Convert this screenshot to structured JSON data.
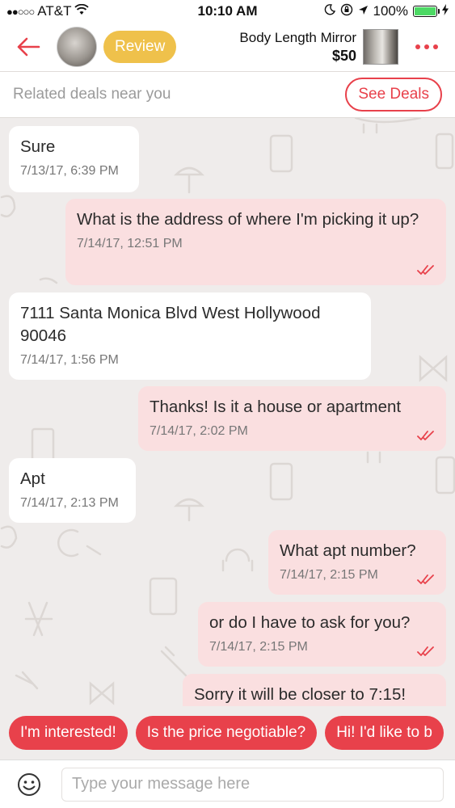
{
  "status_bar": {
    "carrier": "AT&T",
    "time": "10:10 AM",
    "battery": "100%"
  },
  "header": {
    "review_label": "Review",
    "listing_title": "Body Length Mirror",
    "listing_price": "$50"
  },
  "deals": {
    "text": "Related deals near you",
    "button": "See Deals"
  },
  "messages": [
    {
      "dir": "in",
      "text": "Sure",
      "time": "7/13/17, 6:39 PM"
    },
    {
      "dir": "out",
      "text": "What is the address of where I'm picking it up?",
      "time": "7/14/17, 12:51 PM"
    },
    {
      "dir": "in",
      "text": "7111 Santa Monica Blvd West Hollywood 90046",
      "time": "7/14/17, 1:56 PM"
    },
    {
      "dir": "out",
      "text": "Thanks! Is it a house or apartment",
      "time": "7/14/17, 2:02 PM"
    },
    {
      "dir": "in",
      "text": "Apt",
      "time": "7/14/17, 2:13 PM"
    },
    {
      "dir": "out",
      "text": "What apt number?",
      "time": "7/14/17, 2:15 PM"
    },
    {
      "dir": "out",
      "text": "or do I have to ask for you?",
      "time": "7/14/17, 2:15 PM"
    },
    {
      "dir": "out",
      "text": "Sorry it will be closer to 7:15!",
      "time": ""
    }
  ],
  "quick_replies": [
    "I'm interested!",
    "Is the price negotiable?",
    "Hi! I'd like to b"
  ],
  "composer": {
    "placeholder": "Type your message here"
  },
  "colors": {
    "accent": "#e8414b",
    "review_badge": "#efc14b",
    "outgoing_bubble": "#fadfe0",
    "incoming_bubble": "#ffffff",
    "chat_background": "#efeceb"
  }
}
